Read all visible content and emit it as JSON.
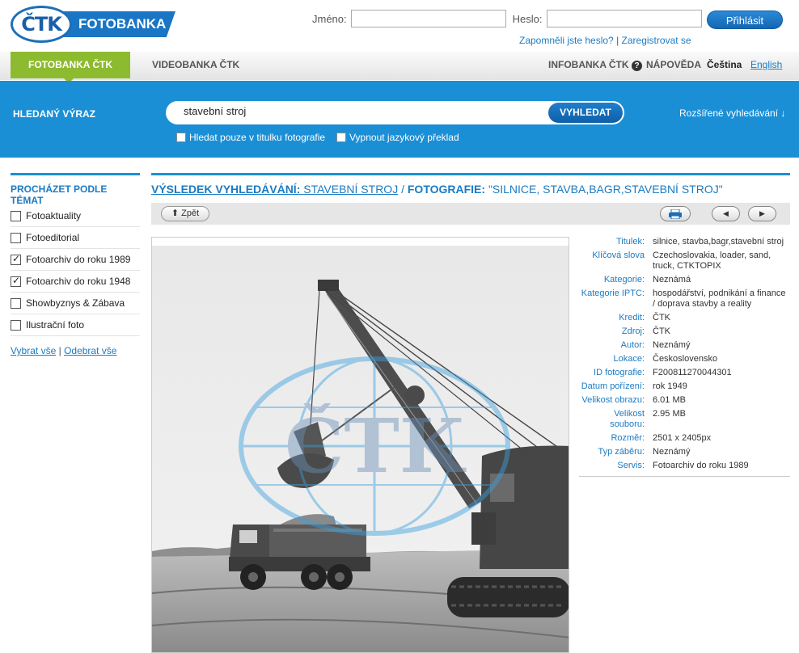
{
  "header": {
    "logo_mark": "ČTK",
    "logo_text": "FOTOBANKA",
    "username_label": "Jméno:",
    "password_label": "Heslo:",
    "login_button": "Přihlásit",
    "forgot_link": "Zapomněli jste heslo?",
    "separator": "|",
    "register_link": "Zaregistrovat se"
  },
  "nav": {
    "tabs": [
      "FOTOBANKA ČTK",
      "VIDEOBANKA ČTK"
    ],
    "infobanka": "INFOBANKA ČTK",
    "help": "NÁPOVĚDA",
    "lang_cs": "Čeština",
    "lang_en": "English"
  },
  "search": {
    "label": "HLEDANÝ VÝRAZ",
    "query": "stavební stroj",
    "button": "VYHLEDAT",
    "option_title_only": "Hledat pouze v titulku fotografie",
    "option_no_translate": "Vypnout jazykový překlad",
    "advanced": "Rozšířené vyhledávání ↓"
  },
  "sidebar": {
    "title": "PROCHÁZET PODLE TÉMAT",
    "items": [
      {
        "label": "Fotoaktuality",
        "checked": false
      },
      {
        "label": "Fotoeditorial",
        "checked": false
      },
      {
        "label": "Fotoarchiv do roku 1989",
        "checked": true
      },
      {
        "label": "Fotoarchiv do roku 1948",
        "checked": true
      },
      {
        "label": "Showbyznys & Zábava",
        "checked": false
      },
      {
        "label": "Ilustrační foto",
        "checked": false
      }
    ],
    "select_all": "Vybrat vše",
    "deselect_all": "Odebrat vše",
    "links_separator": "|"
  },
  "breadcrumb": {
    "result_label": "VÝSLEDEK VYHLEDÁVÁNÍ:",
    "result_value": "STAVEBNÍ STROJ",
    "separator": "/",
    "photo_label": "FOTOGRAFIE:",
    "photo_value": "\"SILNICE, STAVBA,BAGR,STAVEBNÍ STROJ\""
  },
  "toolbar": {
    "back": "Zpět"
  },
  "photo": {
    "watermark": "ČTK"
  },
  "metadata": [
    {
      "key": "Titulek:",
      "value": "silnice, stavba,bagr,stavební stroj"
    },
    {
      "key": "Klíčová slova",
      "value": "Czechoslovakia, loader, sand, truck, CTKTOPIX"
    },
    {
      "key": "Kategorie:",
      "value": "Neznámá"
    },
    {
      "key": "Kategorie IPTC:",
      "value": "hospodářství, podnikání a finance / doprava stavby a reality"
    },
    {
      "key": "Kredit:",
      "value": "ČTK"
    },
    {
      "key": "Zdroj:",
      "value": "ČTK"
    },
    {
      "key": "Autor:",
      "value": "Neznámý"
    },
    {
      "key": "Lokace:",
      "value": "Československo"
    },
    {
      "key": "ID fotografie:",
      "value": "F200811270044301"
    },
    {
      "key": "Datum pořízení:",
      "value": "rok 1949"
    },
    {
      "key": "Velikost obrazu:",
      "value": "6.01 MB"
    },
    {
      "key": "Velikost souboru:",
      "value": "2.95 MB"
    },
    {
      "key": "Rozměr:",
      "value": "2501 x 2405px"
    },
    {
      "key": "Typ záběru:",
      "value": "Neznámý"
    },
    {
      "key": "Servis:",
      "value": "Fotoarchiv do roku 1989"
    }
  ]
}
